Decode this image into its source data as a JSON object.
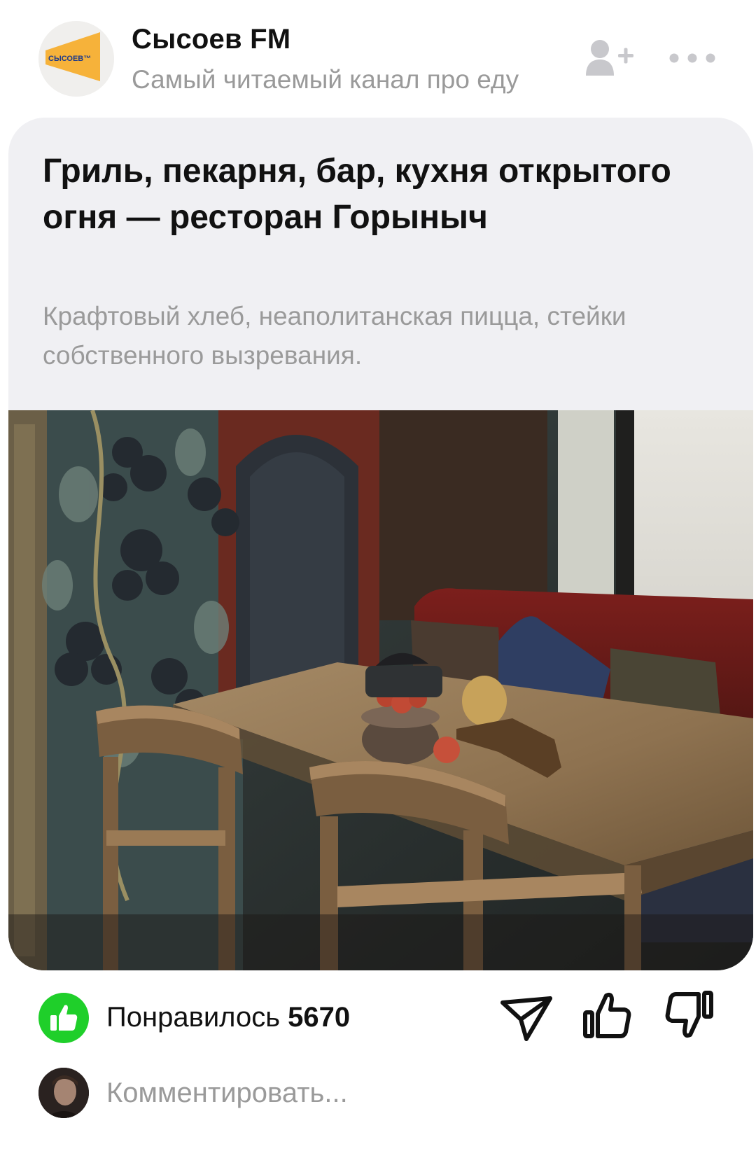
{
  "channel": {
    "name": "Сысоев FM",
    "description": "Самый читаемый канал про еду",
    "logo_text": "СЫСОЕВ™",
    "logo_color": "#f6b23a"
  },
  "post": {
    "title": "Гриль, пекарня, бар, кухня открытого огня — ресторан Горыныч",
    "subtitle": "Крафтовый хлеб, неаполитанская пицца, стейки собственного вызревания."
  },
  "reactions": {
    "likes_label": "Понравилось",
    "likes_count": "5670",
    "like_badge_color": "#1fcf2a"
  },
  "comment": {
    "placeholder": "Комментировать..."
  },
  "icons": {
    "subscribe": "add-user-icon",
    "more": "more-dots-icon",
    "share": "send-icon",
    "like": "thumb-up-icon",
    "dislike": "thumb-down-icon"
  }
}
